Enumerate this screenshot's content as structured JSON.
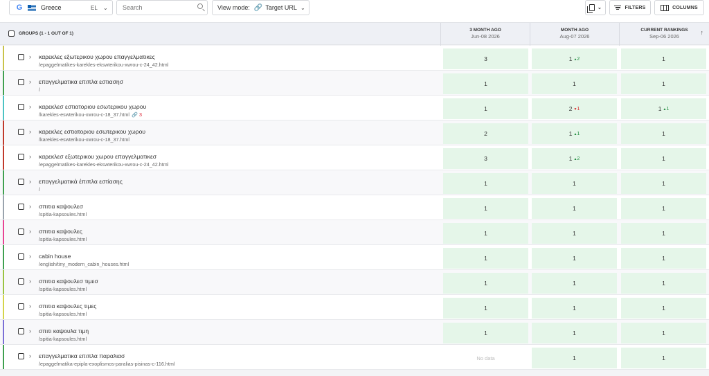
{
  "toolbar": {
    "location": "Greece",
    "language": "EL",
    "search_placeholder": "Search",
    "view_mode_label": "View mode:",
    "view_mode_value": "Target URL",
    "filters_label": "FILTERS",
    "columns_label": "COLUMNS"
  },
  "header": {
    "groups_label": "GROUPS (1 - 1 OUT OF 1)",
    "columns": [
      {
        "title": "3 MONTH AGO",
        "date": "Jun-08 2026"
      },
      {
        "title": "MONTH AGO",
        "date": "Aug-07 2026"
      },
      {
        "title": "CURRENT RANKINGS",
        "date": "Sep-06 2026"
      }
    ]
  },
  "rows": [
    {
      "keyword": "καρεκλες εξωτερικου χωρου επαγγελματικες",
      "url": "/epaggelmatikes-karekles-ekswterikou-xwrou-c-24_42.html",
      "color": "#c9c34a",
      "r1": "3",
      "r2": "1",
      "r2d": "2",
      "r2dir": "up",
      "r3": "1",
      "r3d": "",
      "r3dir": ""
    },
    {
      "keyword": "επαγγελματικα επιπλα εστιασησ",
      "url": "/",
      "color": "#3fa04f",
      "r1": "1",
      "r2": "1",
      "r2d": "",
      "r2dir": "",
      "r3": "1",
      "r3d": "",
      "r3dir": ""
    },
    {
      "keyword": "καρεκλεσ εστιατοριου εσωτερικου χωρου",
      "url": "/karekles-eswterikou-xwrou-c-18_37.html",
      "link_count": "3",
      "color": "#4cc3c3",
      "r1": "1",
      "r2": "2",
      "r2d": "1",
      "r2dir": "down",
      "r3": "1",
      "r3d": "1",
      "r3dir": "up"
    },
    {
      "keyword": "καρεκλες εστιατοριου εσωτερικου χωρου",
      "url": "/karekles-eswterikou-xwrou-c-18_37.html",
      "color": "#c0392b",
      "r1": "2",
      "r2": "1",
      "r2d": "1",
      "r2dir": "up",
      "r3": "1",
      "r3d": "",
      "r3dir": ""
    },
    {
      "keyword": "καρεκλεσ εξωτερικου χωρου επαγγελματικεσ",
      "url": "/epaggelmatikes-karekles-ekswterikou-xwrou-c-24_42.html",
      "color": "#c0392b",
      "r1": "3",
      "r2": "1",
      "r2d": "2",
      "r2dir": "up",
      "r3": "1",
      "r3d": "",
      "r3dir": ""
    },
    {
      "keyword": "επαγγελματικά έπιπλα εστίασης",
      "url": "/",
      "color": "#3fa04f",
      "r1": "1",
      "r2": "1",
      "r2d": "",
      "r2dir": "",
      "r3": "1",
      "r3d": "",
      "r3dir": ""
    },
    {
      "keyword": "σπιτια καψουλεσ",
      "url": "/spitia-kapsoules.html",
      "color": "#9aa3ad",
      "r1": "1",
      "r2": "1",
      "r2d": "",
      "r2dir": "",
      "r3": "1",
      "r3d": "",
      "r3dir": ""
    },
    {
      "keyword": "σπιτια καψουλες",
      "url": "/spitia-kapsoules.html",
      "color": "#e84393",
      "r1": "1",
      "r2": "1",
      "r2d": "",
      "r2dir": "",
      "r3": "1",
      "r3d": "",
      "r3dir": ""
    },
    {
      "keyword": "cabin house",
      "url": "/english/tiny_modern_cabin_houses.html",
      "color": "#3fa04f",
      "r1": "1",
      "r2": "1",
      "r2d": "",
      "r2dir": "",
      "r3": "1",
      "r3d": "",
      "r3dir": ""
    },
    {
      "keyword": "σπιτια καψουλεσ τιμεσ",
      "url": "/spitia-kapsoules.html",
      "color": "#9ac341",
      "r1": "1",
      "r2": "1",
      "r2d": "",
      "r2dir": "",
      "r3": "1",
      "r3d": "",
      "r3dir": ""
    },
    {
      "keyword": "σπιτια καψουλες τιμες",
      "url": "/spitia-kapsoules.html",
      "color": "#d4d44a",
      "r1": "1",
      "r2": "1",
      "r2d": "",
      "r2dir": "",
      "r3": "1",
      "r3d": "",
      "r3dir": ""
    },
    {
      "keyword": "σπιτι καψουλα τιμη",
      "url": "/spitia-kapsoules.html",
      "color": "#7b6fd6",
      "r1": "1",
      "r2": "1",
      "r2d": "",
      "r2dir": "",
      "r3": "1",
      "r3d": "",
      "r3dir": ""
    },
    {
      "keyword": "επαγγελματικα επιπλα παραλιασ",
      "url": "/epaggelmatika-epipla-exoplismos-paralias-pisinas-c-116.html",
      "color": "#3fa04f",
      "r1": "No data",
      "r2": "1",
      "r2d": "",
      "r2dir": "",
      "r3": "1",
      "r3d": "",
      "r3dir": ""
    }
  ]
}
